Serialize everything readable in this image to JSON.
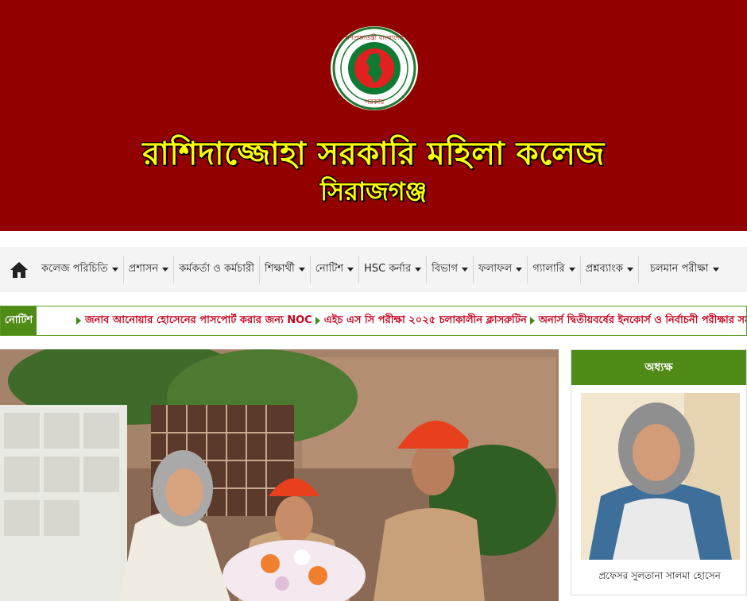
{
  "header": {
    "seal_text_top": "গণপ্রজাতন্ত্রী বাংলাদেশ",
    "seal_text_bottom": "সরকার",
    "college_name": "রাশিদাজ্জোহা সরকারি মহিলা কলেজ",
    "college_city": "সিরাজগঞ্জ"
  },
  "nav": {
    "home_icon": "home-icon",
    "items": [
      {
        "label": "কলেজ পরিচিতি",
        "has_caret": true
      },
      {
        "label": "প্রশাসন",
        "has_caret": true
      },
      {
        "label": "কর্মকর্তা ও কর্মচারী",
        "has_caret": false
      },
      {
        "label": "শিক্ষার্থী",
        "has_caret": true
      },
      {
        "label": "নোটিশ",
        "has_caret": true
      },
      {
        "label": "HSC কর্নার",
        "has_caret": true
      },
      {
        "label": "বিভাগ",
        "has_caret": true
      },
      {
        "label": "ফলাফল",
        "has_caret": true
      },
      {
        "label": "গ্যালারি",
        "has_caret": true
      },
      {
        "label": "প্রশ্নব্যাংক",
        "has_caret": true
      },
      {
        "label": "চলমান পরীক্ষা",
        "has_caret": true
      }
    ]
  },
  "ticker": {
    "label": "নোটিশ",
    "items": [
      "জনাব আনোয়ার হোসেনের পাসপোর্ট করার জন্য NOC",
      "এইচ এস সি পরীক্ষা ২০২৫ চলাকালীন ক্লাসরুটিন",
      "অনার্স দ্বিতীয়বর্ষের ইনকোর্স ও নির্বাচনী পরীক্ষার সময়সূচি"
    ]
  },
  "principal": {
    "heading": "অধ্যক্ষ",
    "name": "প্রফেসর সুলতানা সালমা হোসেন"
  },
  "colors": {
    "banner": "#930000",
    "title_yellow": "#ffff00",
    "green": "#4f8b16",
    "ticker_text": "#c4001a"
  }
}
